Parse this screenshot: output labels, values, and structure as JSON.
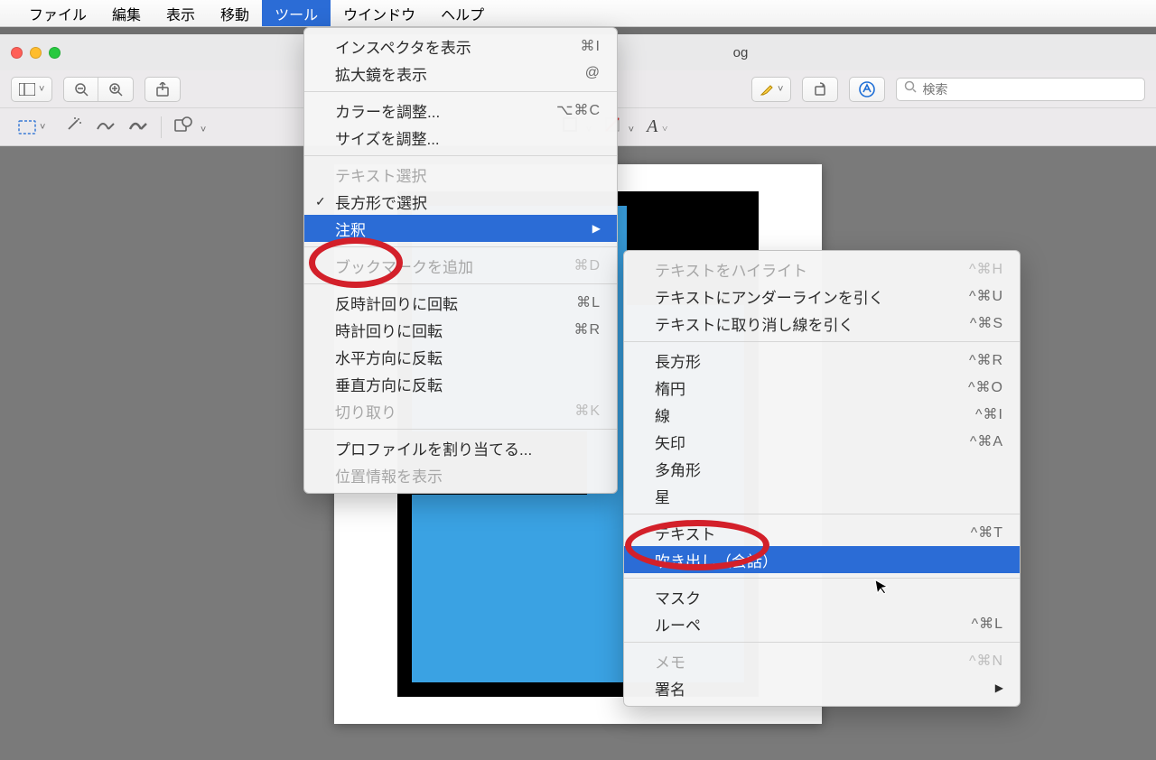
{
  "menubar": {
    "items": [
      "ファイル",
      "編集",
      "表示",
      "移動",
      "ツール",
      "ウインドウ",
      "ヘルプ"
    ],
    "active_index": 4
  },
  "window": {
    "title_suffix": "og"
  },
  "toolbar1": {
    "sidebar_icon": "sidebar-icon",
    "zoom_out": "−",
    "zoom_in": "+",
    "share_icon": "share-icon",
    "highlighter_icon": "highlighter-icon",
    "rotate_icon": "rotate-icon",
    "markup_icon": "markup-icon",
    "search_icon": "🔍",
    "search_placeholder": "検索"
  },
  "toolbar2": {
    "select_icon": "selection-icon",
    "wand_icon": "wand-icon",
    "sketch_icon": "sketch-icon",
    "draw_icon": "draw-icon",
    "shapes_icon": "shapes-icon",
    "border_icon": "border-icon",
    "fill_icon": "fill-icon",
    "text_style_icon": "A"
  },
  "tools_menu": [
    {
      "label": "インスペクタを表示",
      "shortcut": "⌘I"
    },
    {
      "label": "拡大鏡を表示",
      "shortcut": "@"
    },
    {
      "sep": true
    },
    {
      "label": "カラーを調整...",
      "shortcut": "⌥⌘C"
    },
    {
      "label": "サイズを調整..."
    },
    {
      "sep": true
    },
    {
      "label": "テキスト選択",
      "disabled": true
    },
    {
      "label": "長方形で選択",
      "marked": true
    },
    {
      "label": "注釈",
      "submenu": true,
      "highlight": true
    },
    {
      "sep": true
    },
    {
      "label": "ブックマークを追加",
      "shortcut": "⌘D",
      "disabled": true
    },
    {
      "sep": true
    },
    {
      "label": "反時計回りに回転",
      "shortcut": "⌘L"
    },
    {
      "label": "時計回りに回転",
      "shortcut": "⌘R"
    },
    {
      "label": "水平方向に反転"
    },
    {
      "label": "垂直方向に反転"
    },
    {
      "label": "切り取り",
      "shortcut": "⌘K",
      "disabled": true
    },
    {
      "sep": true
    },
    {
      "label": "プロファイルを割り当てる..."
    },
    {
      "label": "位置情報を表示",
      "disabled": true
    }
  ],
  "annotate_menu": [
    {
      "label": "テキストをハイライト",
      "shortcut": "^⌘H",
      "disabled": true
    },
    {
      "label": "テキストにアンダーラインを引く",
      "shortcut": "^⌘U"
    },
    {
      "label": "テキストに取り消し線を引く",
      "shortcut": "^⌘S"
    },
    {
      "sep": true
    },
    {
      "label": "長方形",
      "shortcut": "^⌘R"
    },
    {
      "label": "楕円",
      "shortcut": "^⌘O"
    },
    {
      "label": "線",
      "shortcut": "^⌘I"
    },
    {
      "label": "矢印",
      "shortcut": "^⌘A"
    },
    {
      "label": "多角形"
    },
    {
      "label": "星"
    },
    {
      "sep": true
    },
    {
      "label": "テキスト",
      "shortcut": "^⌘T"
    },
    {
      "label": "吹き出し（会話）",
      "highlight": true
    },
    {
      "sep": true
    },
    {
      "label": "マスク"
    },
    {
      "label": "ルーペ",
      "shortcut": "^⌘L"
    },
    {
      "sep": true
    },
    {
      "label": "メモ",
      "shortcut": "^⌘N",
      "disabled": true
    },
    {
      "label": "署名",
      "submenu": true
    }
  ]
}
